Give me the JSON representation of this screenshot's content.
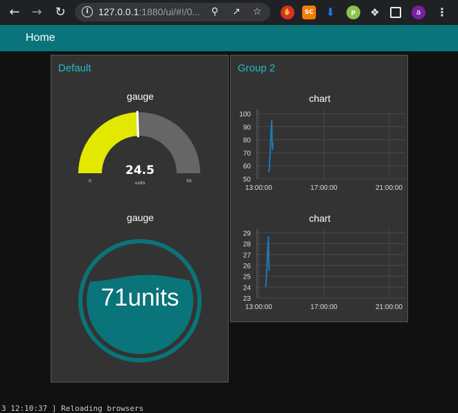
{
  "browser": {
    "url_host": "127.0.0.1",
    "url_rest": ":1880/ui/#!/0...",
    "profile_initial": "a"
  },
  "dashboard": {
    "tab_title": "Home",
    "groups": [
      {
        "title": "Default",
        "widgets": [
          {
            "type": "gauge",
            "title": "gauge",
            "value": "24.5",
            "units": "units",
            "min": "0",
            "max": "50",
            "fill_fraction": 0.49,
            "color": "#e2e800"
          },
          {
            "type": "level",
            "title": "gauge",
            "display": "71units",
            "level_fraction": 0.71,
            "color": "#097479"
          }
        ]
      },
      {
        "title": "Group 2",
        "widgets": [
          {
            "type": "chart",
            "title": "chart"
          },
          {
            "type": "chart",
            "title": "chart"
          }
        ]
      }
    ]
  },
  "colors": {
    "accent": "#097479",
    "card": "#333333",
    "group_title": "#1bbfc7",
    "series": "#1f77b4",
    "gauge_track": "#666666"
  },
  "footer": {
    "console_text": "3 12:10:37 ] Reloading browsers"
  },
  "chart_data": [
    {
      "type": "line",
      "title": "chart",
      "xlabel": "",
      "ylabel": "",
      "x_ticks": [
        "13:00:00",
        "17:00:00",
        "21:00:00"
      ],
      "y_ticks": [
        100,
        90,
        80,
        70,
        60,
        50
      ],
      "ylim": [
        50,
        100
      ],
      "xlim_hours": [
        12.9,
        22.0
      ],
      "series": [
        {
          "x": [
            13.6,
            13.65,
            13.7,
            13.75,
            13.8,
            13.82,
            13.85,
            13.87
          ],
          "y": [
            55,
            57,
            70,
            85,
            95,
            80,
            72,
            78
          ]
        }
      ]
    },
    {
      "type": "line",
      "title": "chart",
      "xlabel": "",
      "ylabel": "",
      "x_ticks": [
        "13:00:00",
        "17:00:00",
        "21:00:00"
      ],
      "y_ticks": [
        29,
        28,
        27,
        26,
        25,
        24,
        23
      ],
      "ylim": [
        23,
        29
      ],
      "xlim_hours": [
        12.9,
        22.0
      ],
      "series": [
        {
          "x": [
            13.4,
            13.45,
            13.5,
            13.55,
            13.6,
            13.62,
            13.65
          ],
          "y": [
            24,
            24.2,
            26,
            27.5,
            28.7,
            26,
            25.5
          ]
        }
      ]
    }
  ]
}
